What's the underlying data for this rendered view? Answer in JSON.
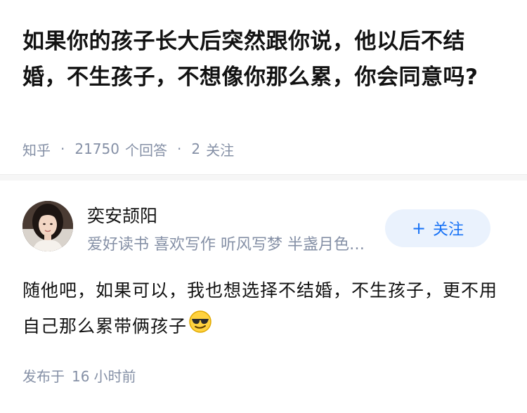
{
  "question": {
    "title": "如果你的孩子长大后突然跟你说，他以后不结婚，不生孩子，不想像你那么累，你会同意吗?",
    "source": "知乎",
    "answer_count": "21750",
    "answer_label": "个回答",
    "follow_count": "2",
    "follow_label": "关注"
  },
  "author": {
    "name": "奕安颉阳",
    "bio": "爱好读书 喜欢写作 听风写梦 半盏月色与清欢",
    "follow_button": "关注",
    "avatar_icon": "woman-portrait-avatar"
  },
  "answer": {
    "text": "随他吧，如果可以，我也想选择不结婚，不生孩子，更不用自己那么累带俩孩子",
    "emoji_icon": "sunglasses-face-icon",
    "time_prefix": "发布于",
    "time_value": "16",
    "time_unit": "小时前"
  },
  "colors": {
    "text": "#121212",
    "meta": "#8590a6",
    "accent": "#1772f6",
    "follow_bg": "#eaf2fd"
  }
}
